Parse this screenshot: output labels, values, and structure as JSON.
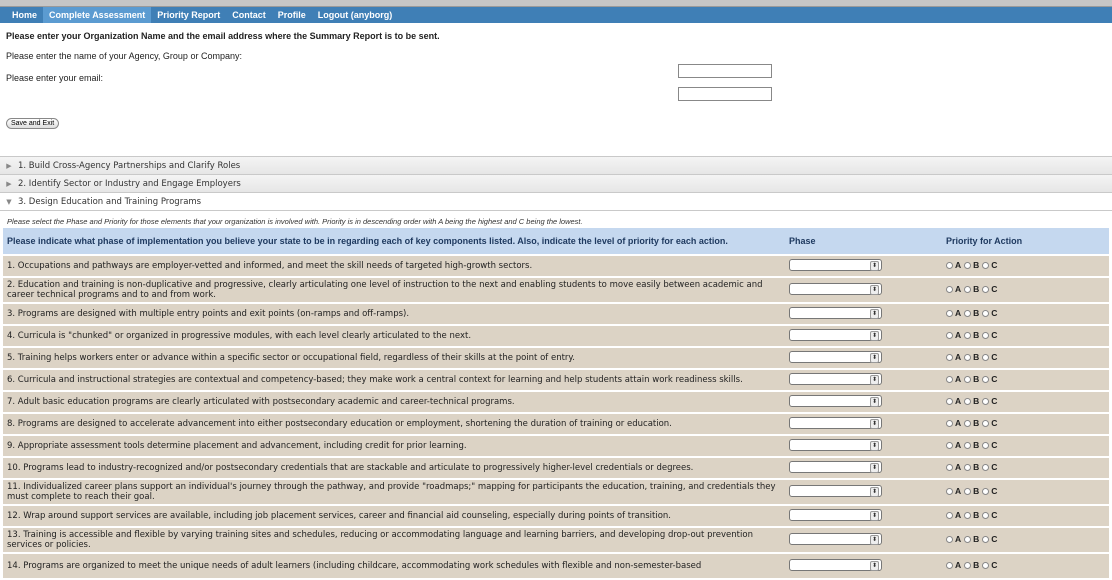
{
  "nav": {
    "items": [
      "Home",
      "Complete Assessment",
      "Priority Report",
      "Contact",
      "Profile",
      "Logout (anyborg)"
    ],
    "active_index": 1
  },
  "intro": {
    "heading": "Please enter your Organization Name and the email address where the Summary Report is to be sent.",
    "org_label": "Please enter the name of your Agency, Group or Company:",
    "email_label": "Please enter your email:",
    "org_value": "",
    "email_value": "",
    "save_button": "Save and Exit"
  },
  "sections": [
    {
      "label": "1. Build Cross-Agency Partnerships and Clarify Roles",
      "expanded": false
    },
    {
      "label": "2. Identify Sector or Industry and Engage Employers",
      "expanded": false
    },
    {
      "label": "3. Design Education and Training Programs",
      "expanded": true
    }
  ],
  "instructions": "Please select the Phase and Priority for those elements that your organization is involved with. Priority is in descending order with A being the highest and C being the lowest.",
  "table": {
    "header_text": "Please indicate what phase of implementation you believe your state to be in regarding each of key components listed. Also, indicate the level of priority for each action.",
    "phase_header": "Phase",
    "priority_header": "Priority for Action",
    "priority_options": [
      "A",
      "B",
      "C"
    ],
    "rows": [
      "1. Occupations and pathways are employer-vetted and informed, and meet the skill needs of targeted high-growth sectors.",
      "2. Education and training is non-duplicative and progressive, clearly articulating one level of instruction to the next and enabling students to move easily between academic and career technical programs and to and from work.",
      "3. Programs are designed with multiple entry points and exit points (on-ramps and off-ramps).",
      "4. Curricula is \"chunked\" or organized in progressive modules, with each level clearly articulated to the next.",
      "5. Training helps workers enter or advance within a specific sector or occupational field, regardless of their skills at the point of entry.",
      "6. Curricula and instructional strategies are contextual and competency-based; they make work a central context for learning and help students attain work readiness skills.",
      "7. Adult basic education programs are clearly articulated with postsecondary academic and career-technical programs.",
      "8. Programs are designed to accelerate advancement into either postsecondary education or employment, shortening the duration of training or education.",
      "9. Appropriate assessment tools determine placement and advancement, including credit for prior learning.",
      "10. Programs lead to industry-recognized and/or postsecondary credentials that are stackable and articulate to progressively higher-level credentials or degrees.",
      "11. Individualized career plans support an individual's journey through the pathway, and provide \"roadmaps;\" mapping for participants the education, training, and credentials they must complete to reach their goal.",
      "12. Wrap around support services are available, including job placement services, career and financial aid counseling, especially during points of transition.",
      "13. Training is accessible and flexible by varying training sites and schedules, reducing or accommodating language and learning barriers, and developing drop-out prevention services or policies.",
      "14. Programs are organized to meet the unique needs of adult learners (including childcare, accommodating work schedules with flexible and non-semester-based"
    ]
  }
}
